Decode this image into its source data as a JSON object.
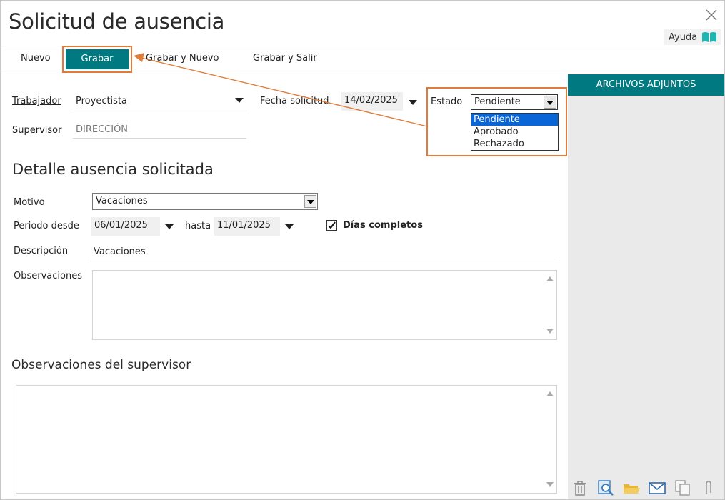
{
  "window": {
    "title": "Solicitud de ausencia",
    "help_label": "Ayuda"
  },
  "toolbar": {
    "new_label": "Nuevo",
    "save_label": "Grabar",
    "save_new_label": "Grabar y Nuevo",
    "save_exit_label": "Grabar y Salir"
  },
  "side_panel": {
    "header": "ARCHIVOS ADJUNTOS",
    "icons": [
      "trash-icon",
      "search-document-icon",
      "folder-open-icon",
      "mail-icon",
      "copy-icon",
      "attachment-icon"
    ]
  },
  "header_fields": {
    "worker_label": "Trabajador",
    "worker_value": "Proyectista",
    "supervisor_label": "Supervisor",
    "supervisor_value": "DIRECCIÓN",
    "request_date_label": "Fecha solicitud",
    "request_date_value": "14/02/2025",
    "status_label": "Estado",
    "status_value": "Pendiente",
    "status_options": [
      "Pendiente",
      "Aprobado",
      "Rechazado"
    ]
  },
  "detail": {
    "section_title": "Detalle ausencia solicitada",
    "reason_label": "Motivo",
    "reason_value": "Vacaciones",
    "period_from_label": "Periodo desde",
    "period_from_value": "06/01/2025",
    "period_to_label": "hasta",
    "period_to_value": "11/01/2025",
    "full_days_label": "Días completos",
    "full_days_checked": true,
    "description_label": "Descripción",
    "description_value": "Vacaciones",
    "observations_label": "Observaciones",
    "observations_value": ""
  },
  "supervisor_notes": {
    "section_title": "Observaciones del supervisor",
    "value": ""
  },
  "colors": {
    "accent": "#007a80",
    "highlight": "#e07b39",
    "selection": "#0a66d6",
    "side_panel_bg": "#eaeaea"
  }
}
